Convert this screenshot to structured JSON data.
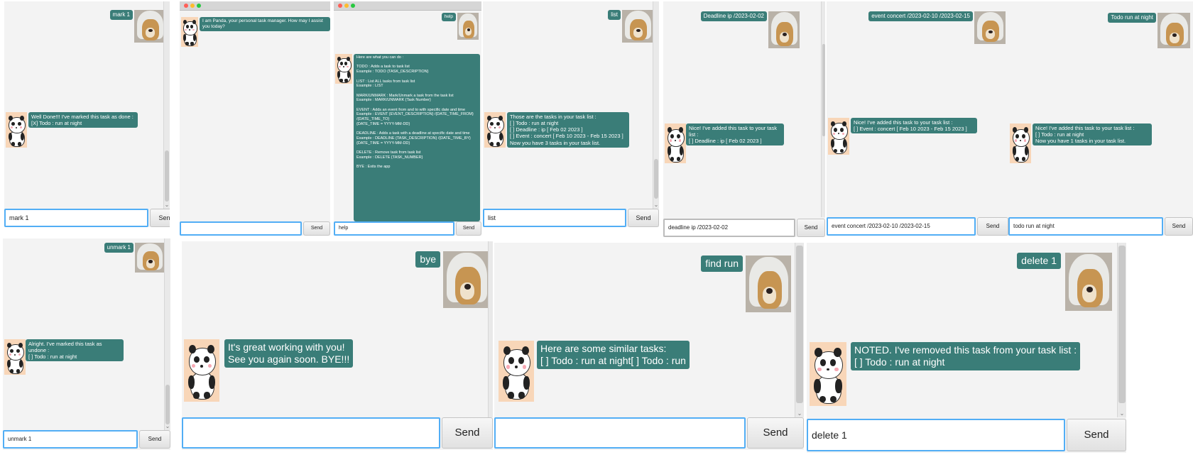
{
  "colors": {
    "bubble": "#3a7d78",
    "panel": "#f3f3f3",
    "input_border": "#52aef5"
  },
  "icons": {
    "user_avatar": "hooded-dog-photo",
    "bot_avatar": "panda-cartoon"
  },
  "send_label": "Send",
  "screens": [
    {
      "user_msg": "mark 1",
      "bot_msg": "Well Done!!! I've marked this task as done :\n[X] Todo : run at night",
      "input": "mark 1"
    },
    {
      "bot_msg": "I am Panda, your personal task manager. How may I assist you today?",
      "input": ""
    },
    {
      "user_msg": "help",
      "bot_msg": "Here are what you can do :\n\nTODO  :  Adds a task to task list\nExample : TODO {TASK_DESCRIPTION}\n\nLIST  :  List ALL tasks from task list\nExample : LIST\n\nMARK/UNMARK  :  Mark/Unmark a task from the task list\nExample : MARK/UNMARK {Task Number}\n\nEVENT  :  Adds an event from and to with specific date and time\nExample : EVENT {EVENT_DESCRIPTION} /{DATE_TIME_FROM} /{DATE_TIME_TO}\n{DATE_TIME = YYYY-MM-DD}\n\nDEADLINE  :  Adds a task with a deadline at specific date and time\nExample : DEADLINE {TASK_DESCRIPTION} /{DATE_TIME_BY}\n{DATE_TIME = YYYY-MM-DD}\n\nDELETE  :  Remove task from task list\nExample : DELETE {TASK_NUMBER}\n\nBYE  :  Exits the app",
      "input": "help"
    },
    {
      "user_msg": "list",
      "bot_msg": "Those are the tasks in your task list :\n[ ] Todo : run at night\n[ ] Deadline : ip [ Feb 02 2023 ]\n[ ] Event : concert [ Feb 10 2023 - Feb 15 2023 ]\nNow you have 3 tasks in your task list.",
      "input": "list"
    },
    {
      "user_msg": "Deadline ip /2023-02-02",
      "bot_msg": "Nice! I've added this task to your task list :\n[ ] Deadline : ip [ Feb 02 2023 ]",
      "input": "deadline ip /2023-02-02"
    },
    {
      "user_msg": "event concert /2023-02-10 /2023-02-15",
      "bot_msg": "Nice! I've added this task to your task list :\n[ ] Event : concert [ Feb 10 2023 - Feb 15 2023 ]",
      "input": "event concert /2023-02-10 /2023-02-15"
    },
    {
      "user_msg": "Todo run at night",
      "bot_msg": "Nice! I've added this task to your task list :\n[ ] Todo : run at night\nNow you have 1 tasks in your task list.",
      "input": "todo run at night"
    },
    {
      "user_msg": "unmark 1",
      "bot_msg": "Alright. I've marked this task as undone :\n[ ] Todo : run at night",
      "input": "unmark 1"
    },
    {
      "user_msg": "bye",
      "bot_msg": "It's great working with you!\nSee you again soon. BYE!!!",
      "input": ""
    },
    {
      "user_msg": "find run",
      "bot_msg": "Here are some similar tasks:\n[ ] Todo : run at night[ ] Todo : run",
      "input": ""
    },
    {
      "user_msg": "delete 1",
      "bot_msg": "NOTED. I've removed this task from your task list :\n[ ] Todo : run at night",
      "input": "delete 1"
    }
  ]
}
